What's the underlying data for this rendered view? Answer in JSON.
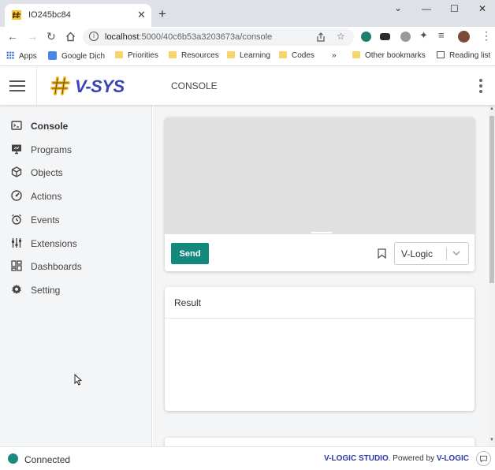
{
  "browser": {
    "tab_title": "IO245bc84",
    "close_glyph": "✕",
    "new_tab_glyph": "+",
    "url_host": "localhost",
    "url_path": ":5000/40c6b53a3203673a/console",
    "window_controls": [
      "⌄",
      "—",
      "☐",
      "✕"
    ],
    "bookmarks": {
      "apps": "Apps",
      "items": [
        "Google Dịch",
        "Priorities",
        "Resources",
        "Learning",
        "Codes"
      ],
      "overflow": "»",
      "other": "Other bookmarks",
      "reading_list": "Reading list"
    }
  },
  "app": {
    "logo_text": "V-SYS",
    "page_title": "CONSOLE",
    "brand_color": "#3b43b5",
    "accent_color": "#12897c"
  },
  "sidebar": {
    "items": [
      {
        "label": "Console",
        "icon": "terminal-icon",
        "active": true
      },
      {
        "label": "Programs",
        "icon": "monitor-code-icon",
        "active": false
      },
      {
        "label": "Objects",
        "icon": "cube-icon",
        "active": false
      },
      {
        "label": "Actions",
        "icon": "speedometer-icon",
        "active": false
      },
      {
        "label": "Events",
        "icon": "alarm-clock-icon",
        "active": false
      },
      {
        "label": "Extensions",
        "icon": "sliders-icon",
        "active": false
      },
      {
        "label": "Dashboards",
        "icon": "dashboard-icon",
        "active": false
      },
      {
        "label": "Setting",
        "icon": "gear-icon",
        "active": false
      }
    ]
  },
  "console": {
    "send_label": "Send",
    "language_selected": "V-Logic",
    "result_title": "Result"
  },
  "footer": {
    "status": "Connected",
    "brand_name": "V-LOGIC STUDIO",
    "powered_by": ". Powered by ",
    "powered_name": "V-LOGIC"
  }
}
